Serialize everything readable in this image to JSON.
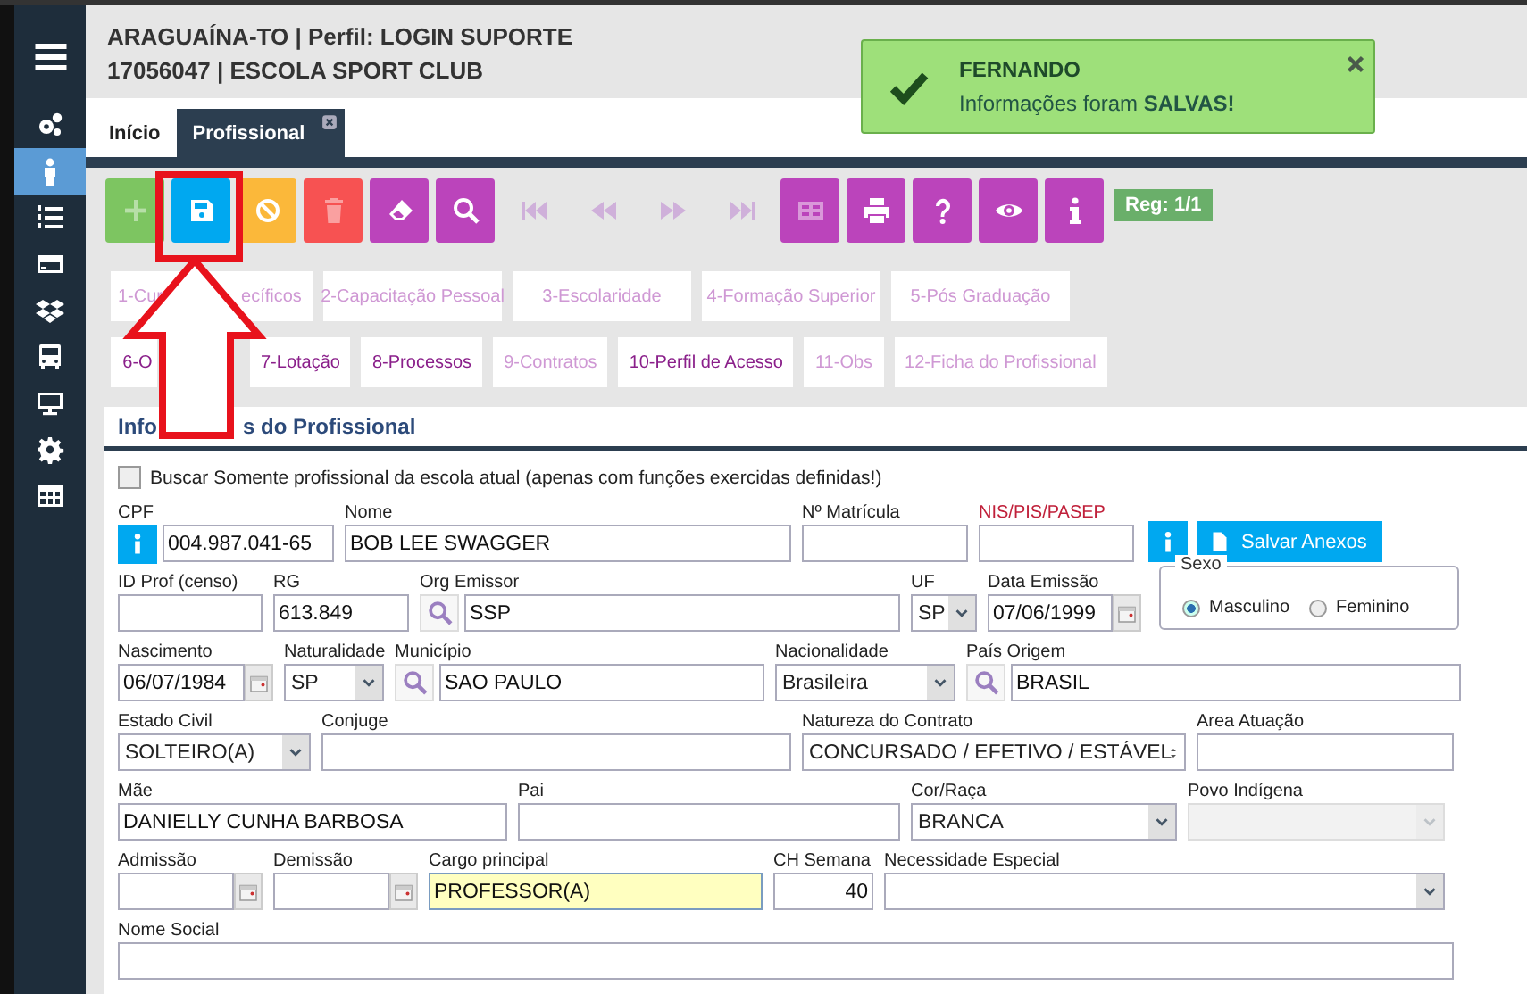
{
  "sidebar": {
    "items": [
      {
        "selected": false
      },
      {
        "selected": true
      },
      {
        "selected": false
      },
      {
        "selected": false
      },
      {
        "selected": false
      },
      {
        "selected": false
      },
      {
        "selected": false
      },
      {
        "selected": false
      },
      {
        "selected": false
      }
    ]
  },
  "header": {
    "lines": [
      "ARAGUAÍNA-TO | Perfil: LOGIN SUPORTE",
      "17056047 | ESCOLA SPORT CLUB"
    ]
  },
  "tabs": [
    {
      "label": "Início",
      "selected": false,
      "closable": false
    },
    {
      "label": "Profissional",
      "selected": true,
      "closable": true
    }
  ],
  "notification": {
    "title": "FERNANDO",
    "message": "Informações foram **SALVAS!**"
  },
  "toolbar": {
    "buttons": [
      {
        "kind": "plus",
        "color": "#7dc561",
        "disabled": true
      },
      {
        "kind": "save",
        "color": "#00a8f0",
        "disabled": false
      },
      {
        "kind": "ban",
        "color": "#fbb83a",
        "disabled": false
      },
      {
        "kind": "trash",
        "color": "#f75252",
        "disabled": true
      },
      {
        "kind": "eraser",
        "color": "#bb44bb",
        "disabled": false
      },
      {
        "kind": "search",
        "color": "#bb44bb",
        "disabled": false
      },
      {
        "kind": "first",
        "disabled": true
      },
      {
        "kind": "prev",
        "disabled": true
      },
      {
        "kind": "next",
        "disabled": true
      },
      {
        "kind": "last",
        "disabled": true
      },
      {
        "kind": "grid",
        "color": "#bb44bb",
        "disabled": true
      },
      {
        "kind": "print",
        "color": "#bb44bb",
        "disabled": false
      },
      {
        "kind": "help",
        "color": "#bb44bb",
        "disabled": false
      },
      {
        "kind": "eye",
        "color": "#bb44bb",
        "disabled": false
      },
      {
        "kind": "info",
        "color": "#bb44bb",
        "disabled": false
      }
    ],
    "record": "Reg: 1/1"
  },
  "sections": [
    [
      {
        "label_parts": [
          "1-Cur",
          "ecíficos"
        ],
        "enabled": false
      },
      {
        "label": "2-Capacitação Pessoal",
        "enabled": false
      },
      {
        "label": "3-Escolaridade",
        "enabled": false
      },
      {
        "label": "4-Formação Superior",
        "enabled": false
      },
      {
        "label": "5-Pós Graduação",
        "enabled": false
      }
    ],
    [
      {
        "label": "6-O",
        "enabled": true
      },
      {
        "label": "7-Lotação",
        "enabled": true
      },
      {
        "label": "8-Processos",
        "enabled": true
      },
      {
        "label": "9-Contratos",
        "enabled": false
      },
      {
        "label": "10-Perfil de Acesso",
        "enabled": true
      },
      {
        "label": "11-Obs",
        "enabled": false
      },
      {
        "label": "12-Ficha do Profissional",
        "enabled": false
      }
    ]
  ],
  "form": {
    "title_parts": [
      "Info",
      "s do Profissional"
    ],
    "filter": {
      "label": "Buscar Somente profissional da escola atual (apenas com funções exercidas definidas!)",
      "checked": false
    },
    "lines": [
      {
        "fields": [
          {
            "kind": "info_text",
            "label": "CPF",
            "value": "004.987.041-65"
          },
          {
            "kind": "text",
            "label": "Nome",
            "value": "BOB LEE SWAGGER"
          },
          {
            "kind": "text",
            "label": "Nº Matrícula"
          },
          {
            "kind": "text",
            "label": "NIS/PIS/PASEP",
            "alert": true
          },
          {
            "kind": "actions",
            "button": "Salvar Anexos"
          }
        ]
      },
      {
        "fields": [
          {
            "kind": "text",
            "label": "ID Prof (censo)"
          },
          {
            "kind": "text",
            "label": "RG",
            "value": "613.849"
          },
          {
            "kind": "lookup",
            "label": "Org Emissor",
            "value": "SSP"
          },
          {
            "kind": "select",
            "label": "UF",
            "value": "SP"
          },
          {
            "kind": "date",
            "label": "Data Emissão",
            "value": "07/06/1999"
          },
          {
            "kind": "radio",
            "label": "Sexo",
            "options": [
              {
                "label": "Masculino",
                "selected": true
              },
              {
                "label": "Feminino",
                "selected": false
              }
            ]
          }
        ]
      },
      {
        "fields": [
          {
            "kind": "date",
            "label": "Nascimento",
            "value": "06/07/1984"
          },
          {
            "kind": "select",
            "label": "Naturalidade",
            "value": "SP"
          },
          {
            "kind": "lookup",
            "label": "Município",
            "value": "SAO PAULO"
          },
          {
            "kind": "select",
            "label": "Nacionalidade",
            "value": "Brasileira"
          },
          {
            "kind": "lookup",
            "label": "País Origem",
            "value": "BRASIL"
          }
        ]
      },
      {
        "fields": [
          {
            "kind": "select",
            "label": "Estado Civil",
            "value": "SOLTEIRO(A)"
          },
          {
            "kind": "text",
            "label": "Conjuge"
          },
          {
            "kind": "spin",
            "label": "Natureza do Contrato",
            "value": "CONCURSADO / EFETIVO / ESTÁVEL"
          },
          {
            "kind": "text",
            "label": "Area Atuação"
          }
        ]
      },
      {
        "fields": [
          {
            "kind": "text",
            "label": "Mãe",
            "value": "DANIELLY CUNHA BARBOSA"
          },
          {
            "kind": "text",
            "label": "Pai"
          },
          {
            "kind": "select",
            "label": "Cor/Raça",
            "value": "BRANCA"
          },
          {
            "kind": "select",
            "label": "Povo Indígena",
            "disabled": true
          }
        ]
      },
      {
        "fields": [
          {
            "kind": "date",
            "label": "Admissão"
          },
          {
            "kind": "date",
            "label": "Demissão"
          },
          {
            "kind": "text",
            "label": "Cargo principal",
            "value": "PROFESSOR(A)",
            "focused": true
          },
          {
            "kind": "number",
            "label": "CH Semana",
            "value": "40"
          },
          {
            "kind": "select",
            "label": "Necessidade Especial"
          }
        ]
      },
      {
        "fields": [
          {
            "kind": "text",
            "label": "Nome Social"
          }
        ]
      }
    ]
  },
  "annotations": [
    {
      "kind": "highlight_box"
    },
    {
      "kind": "arrow"
    }
  ]
}
